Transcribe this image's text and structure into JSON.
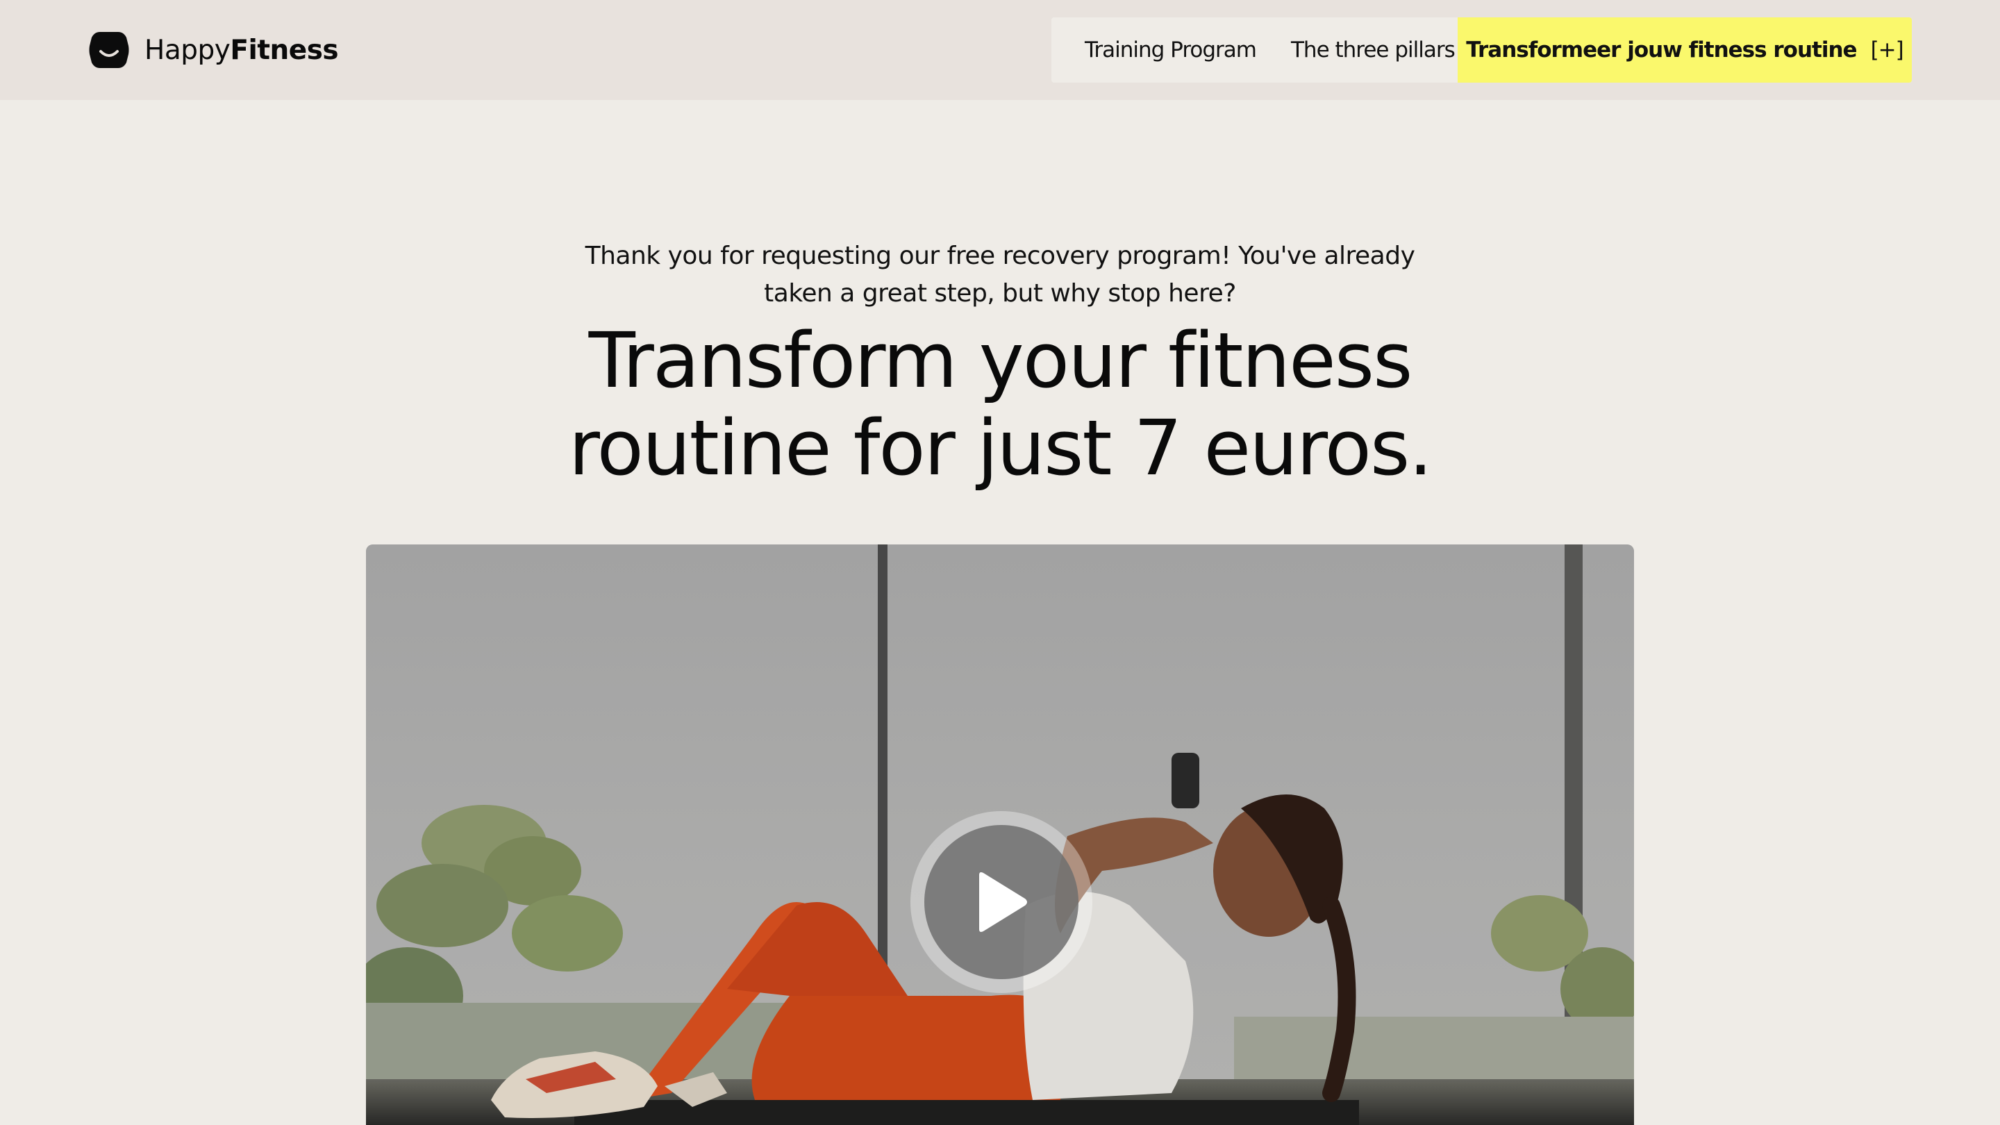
{
  "brand": {
    "name_light": "Happy",
    "name_bold": "Fitness",
    "logo_icon": "smile-blob-icon"
  },
  "nav": {
    "items": [
      {
        "label": "Training Program"
      },
      {
        "label": "The three pillars"
      }
    ],
    "cta": {
      "label": "Transformeer jouw fitness routine",
      "icon_text": "[+]",
      "color": "#faf86c"
    }
  },
  "hero": {
    "intro": "Thank you for requesting our free recovery program! You've already taken a great step, but why stop here?",
    "headline": "Transform your fitness routine for just 7 euros."
  },
  "video": {
    "play_icon": "play-icon"
  },
  "colors": {
    "background": "#efece7",
    "header": "#e8e2dd",
    "accent": "#faf86c"
  }
}
